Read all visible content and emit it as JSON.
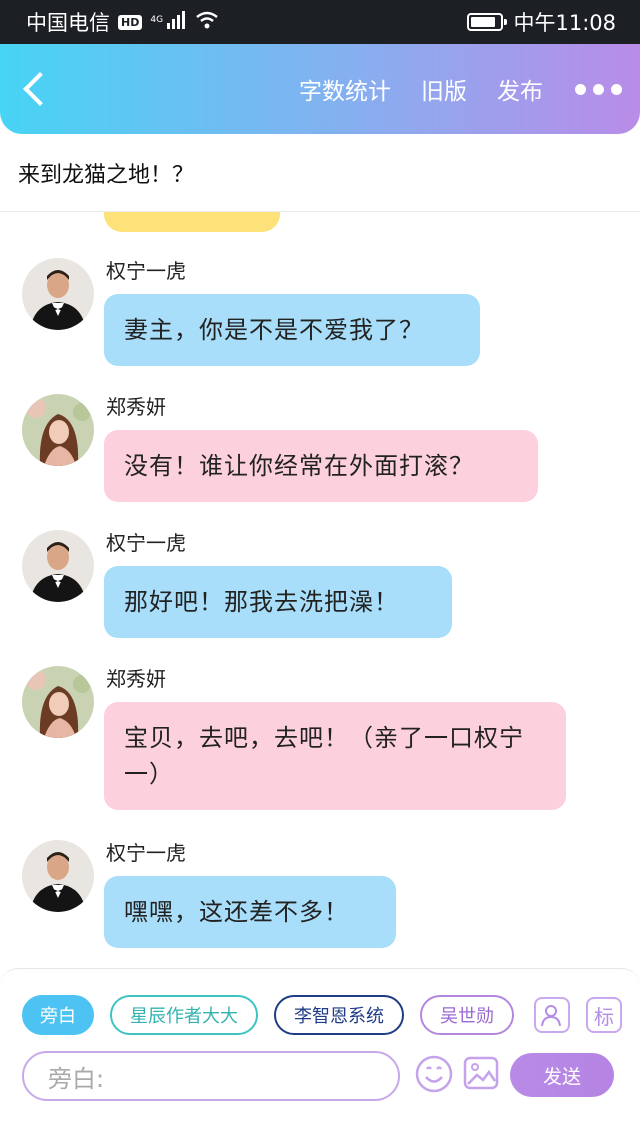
{
  "status_bar": {
    "carrier": "中国电信",
    "hd": "HD",
    "network": "4G",
    "time": "中午11:08",
    "battery_level": 0.85
  },
  "header": {
    "actions": [
      "字数统计",
      "旧版",
      "发布"
    ]
  },
  "story": {
    "title": "来到龙猫之地！？"
  },
  "messages": [
    {
      "sender": "权宁一虎",
      "text": "妻主，你是不是不爱我了？",
      "style": "blue",
      "avatar": "man-in-tuxedo-avatar"
    },
    {
      "sender": "郑秀妍",
      "text": "没有！谁让你经常在外面打滚？",
      "style": "pink",
      "avatar": "woman-long-hair-avatar"
    },
    {
      "sender": "权宁一虎",
      "text": "那好吧！那我去洗把澡！",
      "style": "blue",
      "avatar": "man-in-tuxedo-avatar"
    },
    {
      "sender": "郑秀妍",
      "text": "宝贝，去吧，去吧！（亲了一口权宁一）",
      "style": "pink",
      "avatar": "woman-long-hair-avatar"
    },
    {
      "sender": "权宁一虎",
      "text": "嘿嘿，这还差不多！",
      "style": "blue",
      "avatar": "man-in-tuxedo-avatar"
    }
  ],
  "composer": {
    "roles": [
      "旁白",
      "星辰作者大大",
      "李智恩系统",
      "吴世勋"
    ],
    "tag_button": "标",
    "input_placeholder": "旁白:",
    "send_label": "发送"
  },
  "colors": {
    "header_gradient_start": "#47d4f5",
    "header_gradient_end": "#b98ce8",
    "bubble_blue": "#a8def9",
    "bubble_pink": "#fcd0dc",
    "bubble_yellow": "#fde27a",
    "accent_purple": "#b88ae6"
  }
}
